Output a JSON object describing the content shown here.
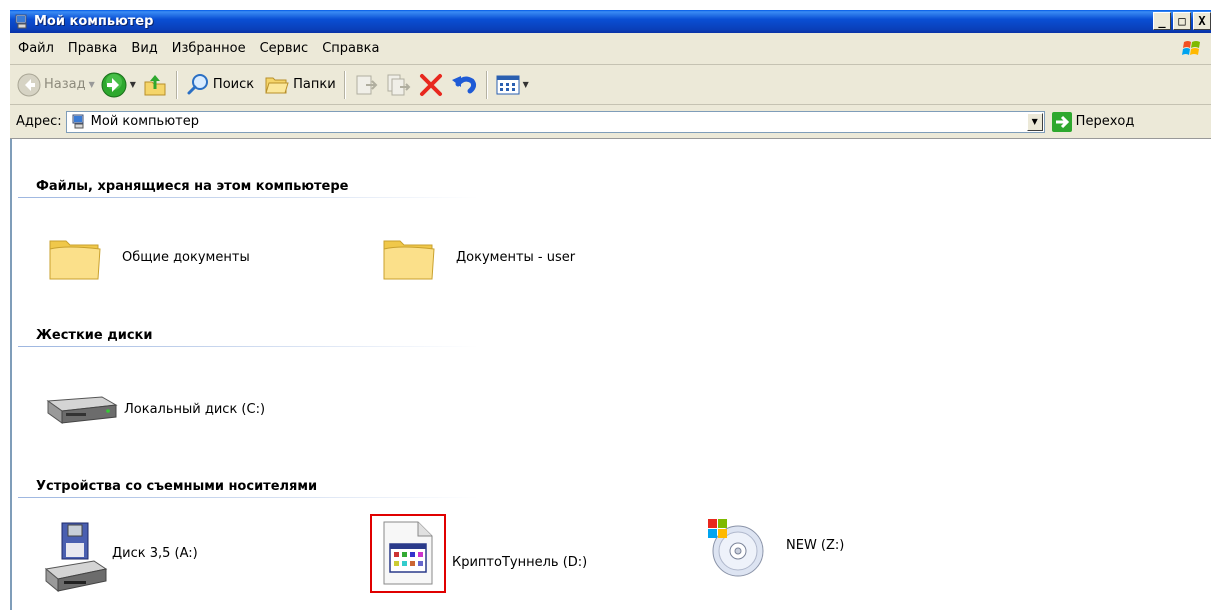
{
  "window": {
    "title": "Мой компьютер",
    "buttons": {
      "minimize": "_",
      "maximize": "□",
      "close": "X"
    }
  },
  "menu": {
    "items": [
      "Файл",
      "Правка",
      "Вид",
      "Избранное",
      "Сервис",
      "Справка"
    ]
  },
  "toolbar": {
    "back_label": "Назад",
    "search_label": "Поиск",
    "folders_label": "Папки"
  },
  "address": {
    "label": "Адрес:",
    "value": "Мой компьютер",
    "go_label": "Переход"
  },
  "groups": [
    {
      "title": "Файлы, хранящиеся на этом компьютере",
      "items": [
        {
          "label": "Общие документы",
          "icon": "folder-icon"
        },
        {
          "label": "Документы - user",
          "icon": "folder-icon"
        }
      ]
    },
    {
      "title": "Жесткие диски",
      "items": [
        {
          "label": "Локальный диск (C:)",
          "icon": "hard-drive-icon"
        }
      ]
    },
    {
      "title": "Устройства со съемными носителями",
      "items": [
        {
          "label": "Диск 3,5 (A:)",
          "icon": "floppy-drive-icon"
        },
        {
          "label": "КриптоТуннель (D:)",
          "icon": "application-file-icon",
          "highlighted": true
        },
        {
          "label": "NEW (Z:)",
          "icon": "cd-drive-icon"
        }
      ]
    }
  ],
  "colors": {
    "titlebar": "#0a4fd4",
    "chrome": "#ece9d8",
    "highlight": "#e00000"
  }
}
